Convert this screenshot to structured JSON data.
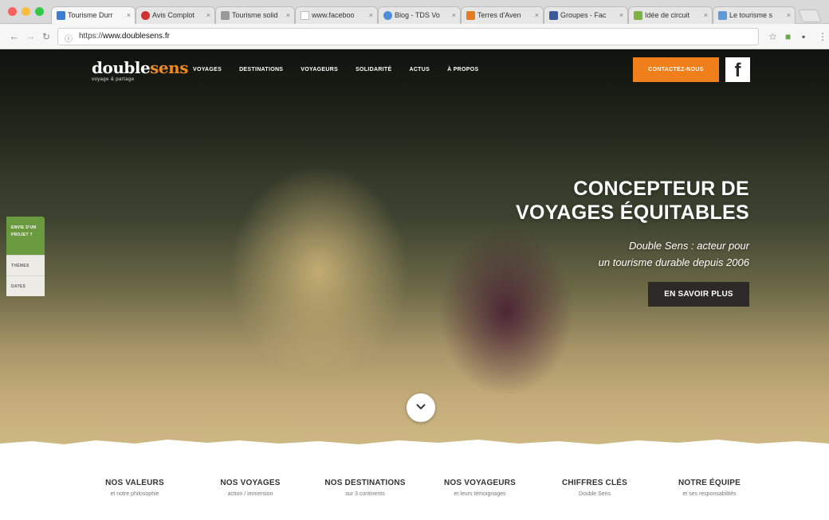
{
  "browser": {
    "tabs": [
      {
        "label": "Tourisme Durr",
        "favicon_color": "#3a7bd5",
        "active": true
      },
      {
        "label": "Avis Complot",
        "favicon_color": "#d32f2f",
        "active": false
      },
      {
        "label": "Tourisme solid",
        "favicon_color": "#999999",
        "active": false
      },
      {
        "label": "www.faceboo",
        "favicon_color": "#bbbbbb",
        "active": false
      },
      {
        "label": "Blog - TDS Vo",
        "favicon_color": "#4a90d9",
        "active": false
      },
      {
        "label": "Terres d'Aven",
        "favicon_color": "#e57c22",
        "active": false
      },
      {
        "label": "Groupes - Fac",
        "favicon_color": "#3b5998",
        "active": false
      },
      {
        "label": "Idée de circuit",
        "favicon_color": "#7cb342",
        "active": false
      },
      {
        "label": "Le tourisme s",
        "favicon_color": "#5c9bd6",
        "active": false
      }
    ],
    "url_scheme": "https://",
    "url_host": "www.doublesens.fr"
  },
  "site": {
    "logo_double": "double",
    "logo_sens": "sens",
    "logo_tagline": "voyage & partage",
    "nav": [
      "VOYAGES",
      "DESTINATIONS",
      "VOYAGEURS",
      "SOLIDARITÉ",
      "ACTUS",
      "À PROPOS"
    ],
    "contact_label": "CONTACTEZ-NOUS",
    "facebook_label": "f"
  },
  "side_tabs": {
    "primary": "ENVIE D'UN PROJET ?",
    "items": [
      "THÈMES",
      "DATES"
    ]
  },
  "hero": {
    "headline_line1": "CONCEPTEUR DE",
    "headline_line2": "VOYAGES ÉQUITABLES",
    "sub_line1": "Double Sens : acteur pour",
    "sub_line2": "un tourisme durable depuis 2006",
    "cta_label": "EN SAVOIR PLUS"
  },
  "features": [
    {
      "title": "NOS VALEURS",
      "sub": "et notre philosophie"
    },
    {
      "title": "NOS VOYAGES",
      "sub": "action / immersion"
    },
    {
      "title": "NOS DESTINATIONS",
      "sub": "sur 3 continents"
    },
    {
      "title": "NOS VOYAGEURS",
      "sub": "et leurs témoignages"
    },
    {
      "title": "CHIFFRES CLÉS",
      "sub": "Double Sens"
    },
    {
      "title": "NOTRE ÉQUIPE",
      "sub": "et ses responsabilités"
    }
  ],
  "colors": {
    "brand_orange": "#ef7f1a",
    "side_green": "#6a9a3e",
    "cta_dark": "#2e2929"
  }
}
